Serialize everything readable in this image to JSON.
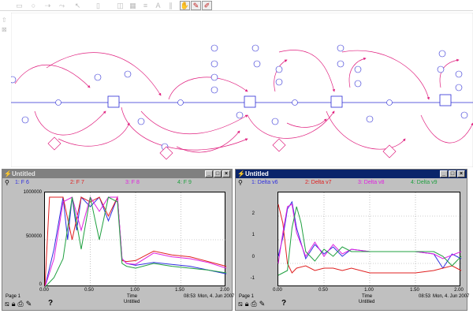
{
  "toolbar": {
    "icons": [
      "rectangle-icon",
      "circle-icon",
      "arrow-icon",
      "connector-icon",
      "pointer-icon",
      "document-icon",
      "graph-icon",
      "table-icon",
      "list-icon",
      "text-icon",
      "dynamite-icon",
      "hand-icon",
      "magic-wand-icon",
      "paintbrush-icon"
    ]
  },
  "diagram": {
    "flow_color": "#2b2bd4",
    "link_color": "#e0207f"
  },
  "graph1": {
    "title": "Untitled",
    "legend": [
      {
        "label": "1: F 6",
        "color": "#2f2fdf"
      },
      {
        "label": "2: F 7",
        "color": "#e02020"
      },
      {
        "label": "3: F 8",
        "color": "#e020e0"
      },
      {
        "label": "4: F 9",
        "color": "#20a040"
      }
    ],
    "y_ticks": [
      "1000000",
      "500000",
      "0"
    ],
    "x_ticks": [
      "0.00",
      "0.50",
      "1.00",
      "1.50",
      "2.00"
    ],
    "page": "Page 1",
    "x_label": "Time",
    "time": "08:53",
    "date": "Mon, 4. Jun 2007",
    "subtitle": "Untitled"
  },
  "graph2": {
    "title": "Untitled",
    "legend": [
      {
        "label": "1: Delta v6",
        "color": "#2f2fdf"
      },
      {
        "label": "2: Delta v7",
        "color": "#e02020"
      },
      {
        "label": "3: Delta v8",
        "color": "#e020e0"
      },
      {
        "label": "4: Delta v9",
        "color": "#20a040"
      }
    ],
    "y_ticks": [
      "2",
      "1",
      "0",
      "-1"
    ],
    "x_ticks": [
      "0.00",
      "0.50",
      "1.00",
      "1.50",
      "2.00"
    ],
    "page": "Page 1",
    "x_label": "Time",
    "time": "08:53",
    "date": "Mon, 4. Jun 2007",
    "subtitle": "Untitled"
  },
  "chart_data": [
    {
      "type": "line",
      "title": "Untitled",
      "xlabel": "Time",
      "xlim": [
        0,
        2
      ],
      "ylim": [
        0,
        1000000
      ],
      "series": [
        {
          "name": "F 6",
          "x": [
            0,
            0.1,
            0.2,
            0.25,
            0.3,
            0.35,
            0.4,
            0.5,
            0.6,
            0.7,
            0.8,
            0.85,
            0.9,
            1.0,
            1.2,
            1.4,
            1.6,
            1.8,
            2.0
          ],
          "values": [
            0,
            400000,
            950000,
            500000,
            950000,
            600000,
            950000,
            850000,
            950000,
            700000,
            950000,
            300000,
            250000,
            230000,
            260000,
            240000,
            220000,
            180000,
            140000
          ]
        },
        {
          "name": "F 7",
          "x": [
            0,
            0.05,
            0.1,
            0.2,
            0.3,
            0.4,
            0.5,
            0.6,
            0.7,
            0.8,
            0.85,
            0.9,
            1.0,
            1.2,
            1.4,
            1.6,
            1.8,
            2.0
          ],
          "values": [
            0,
            950000,
            950000,
            950000,
            500000,
            950000,
            900000,
            950000,
            750000,
            950000,
            280000,
            270000,
            280000,
            380000,
            340000,
            320000,
            270000,
            220000
          ]
        },
        {
          "name": "F 8",
          "x": [
            0,
            0.1,
            0.2,
            0.3,
            0.4,
            0.5,
            0.6,
            0.7,
            0.8,
            0.85,
            0.9,
            1.0,
            1.2,
            1.4,
            1.6,
            1.8,
            2.0
          ],
          "values": [
            0,
            300000,
            900000,
            950000,
            600000,
            950000,
            800000,
            950000,
            950000,
            300000,
            250000,
            240000,
            360000,
            320000,
            300000,
            260000,
            200000
          ]
        },
        {
          "name": "F 9",
          "x": [
            0,
            0.1,
            0.2,
            0.3,
            0.4,
            0.5,
            0.6,
            0.7,
            0.8,
            0.85,
            0.9,
            1.0,
            1.2,
            1.4,
            1.6,
            1.8,
            2.0
          ],
          "values": [
            0,
            100000,
            300000,
            950000,
            400000,
            950000,
            500000,
            950000,
            900000,
            250000,
            220000,
            200000,
            250000,
            220000,
            200000,
            180000,
            150000
          ]
        }
      ]
    },
    {
      "type": "line",
      "title": "Untitled",
      "xlabel": "Time",
      "xlim": [
        0,
        2
      ],
      "ylim": [
        -1.5,
        2.5
      ],
      "series": [
        {
          "name": "Delta v6",
          "x": [
            0,
            0.05,
            0.1,
            0.15,
            0.2,
            0.3,
            0.4,
            0.5,
            0.6,
            0.7,
            0.8,
            1.0,
            1.2,
            1.5,
            1.7,
            1.8,
            1.9,
            2.0
          ],
          "values": [
            -0.2,
            0.6,
            1.8,
            2.1,
            1.0,
            -0.3,
            0.3,
            -0.1,
            0.2,
            -0.2,
            0.1,
            0,
            0,
            0,
            -0.1,
            -0.7,
            -0.1,
            -0.3
          ]
        },
        {
          "name": "Delta v7",
          "x": [
            0,
            0.05,
            0.1,
            0.15,
            0.2,
            0.3,
            0.4,
            0.5,
            0.6,
            0.7,
            0.8,
            1.0,
            1.2,
            1.5,
            1.7,
            1.9,
            2.0
          ],
          "values": [
            2.0,
            1.2,
            -0.5,
            -0.9,
            -0.7,
            -0.6,
            -0.8,
            -0.7,
            -0.7,
            -0.8,
            -0.7,
            -0.9,
            -0.9,
            -0.9,
            -0.8,
            -0.6,
            -0.8
          ]
        },
        {
          "name": "Delta v8",
          "x": [
            0,
            0.05,
            0.1,
            0.15,
            0.2,
            0.3,
            0.4,
            0.5,
            0.6,
            0.7,
            0.8,
            1.0,
            1.2,
            1.5,
            1.7,
            1.8,
            2.0
          ],
          "values": [
            -0.5,
            0.8,
            1.9,
            2.0,
            0.8,
            -0.2,
            0.4,
            -0.2,
            0.3,
            -0.1,
            0.1,
            0,
            0,
            0,
            -0.1,
            -0.3,
            0
          ]
        },
        {
          "name": "Delta v9",
          "x": [
            0,
            0.1,
            0.15,
            0.2,
            0.25,
            0.3,
            0.4,
            0.5,
            0.6,
            0.7,
            0.8,
            1.0,
            1.2,
            1.5,
            1.7,
            1.8,
            1.9,
            2.0
          ],
          "values": [
            -1.0,
            -0.8,
            1.0,
            1.9,
            1.2,
            0,
            -0.4,
            0.1,
            -0.2,
            0.2,
            0,
            0,
            0,
            0,
            0,
            -0.2,
            -0.6,
            -0.2
          ]
        }
      ]
    }
  ]
}
